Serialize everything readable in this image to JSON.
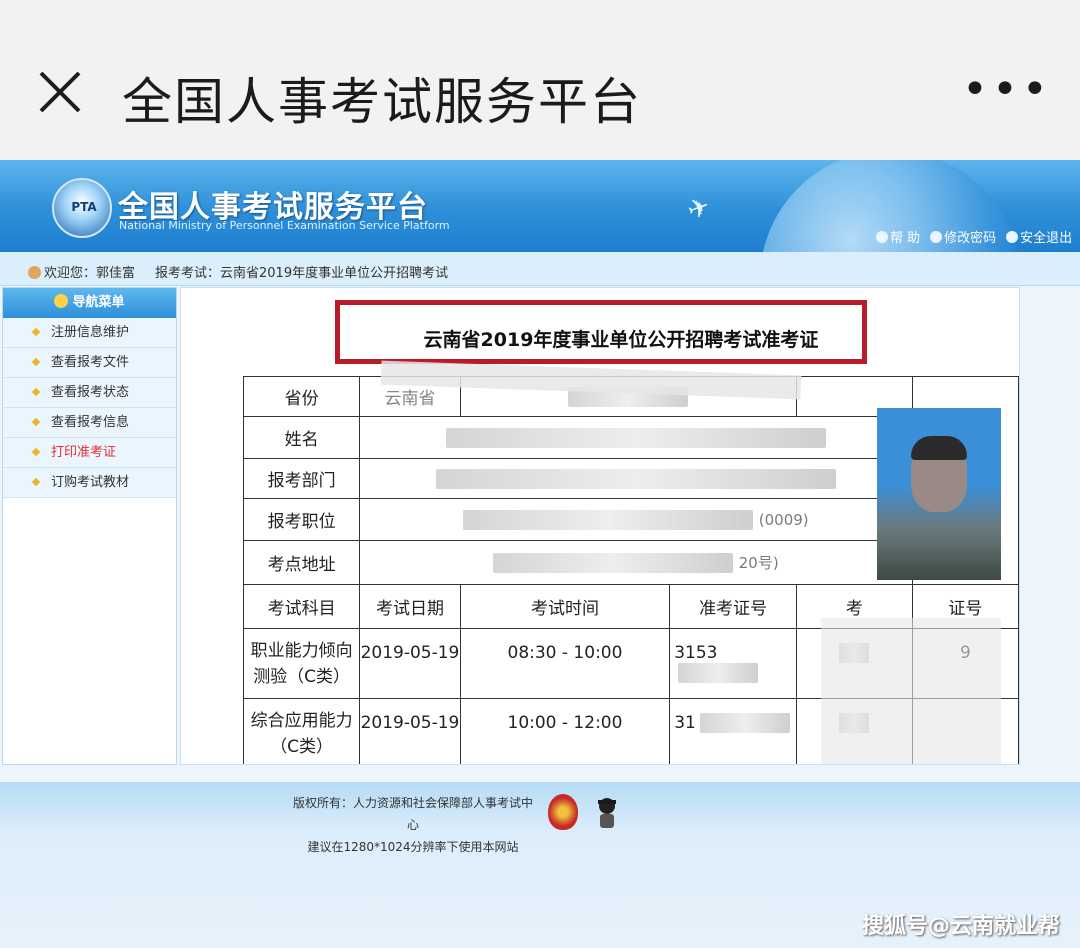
{
  "wechat": {
    "title": "全国人事考试服务平台",
    "close_icon": "close-icon",
    "more_label": "•••"
  },
  "site": {
    "title": "全国人事考试服务平台",
    "subtitle": "National Ministry of Personnel Examination Service Platform",
    "logo_text": "PTA",
    "links": [
      "帮 助",
      "修改密码",
      "安全退出"
    ]
  },
  "welcome": {
    "greeting": "欢迎您：郭佳富",
    "exam": "报考考试：云南省2019年度事业单位公开招聘考试"
  },
  "nav": {
    "header": "导航菜单",
    "items": [
      "注册信息维护",
      "查看报考文件",
      "查看报考状态",
      "查看报考信息",
      "打印准考证",
      "订购考试教材"
    ],
    "active_index": 4
  },
  "ticket": {
    "title": "云南省2019年度事业单位公开招聘考试准考证",
    "labels": [
      "省份",
      "姓名",
      "报考部门",
      "报考职位",
      "考点地址"
    ],
    "province_partial": "云南省",
    "position_partial": "(0009)",
    "address_partial": "20号)",
    "headers": [
      "考试科目",
      "考试日期",
      "考试时间",
      "准考证号",
      "考",
      "证号"
    ],
    "rows": [
      {
        "subject": "职业能力倾向测验（C类）",
        "date": "2019-05-19",
        "time": "08:30 - 10:00",
        "id_partial": "3153",
        "seat_partial": "9"
      },
      {
        "subject": "综合应用能力（C类）",
        "date": "2019-05-19",
        "time": "10:00 - 12:00",
        "id_partial": "31",
        "seat_partial": ""
      }
    ]
  },
  "footer": {
    "copyright": "版权所有：人力资源和社会保障部人事考试中心",
    "advice": "建议在1280*1024分辨率下使用本网站"
  },
  "watermark": "搜狐号@云南就业帮"
}
